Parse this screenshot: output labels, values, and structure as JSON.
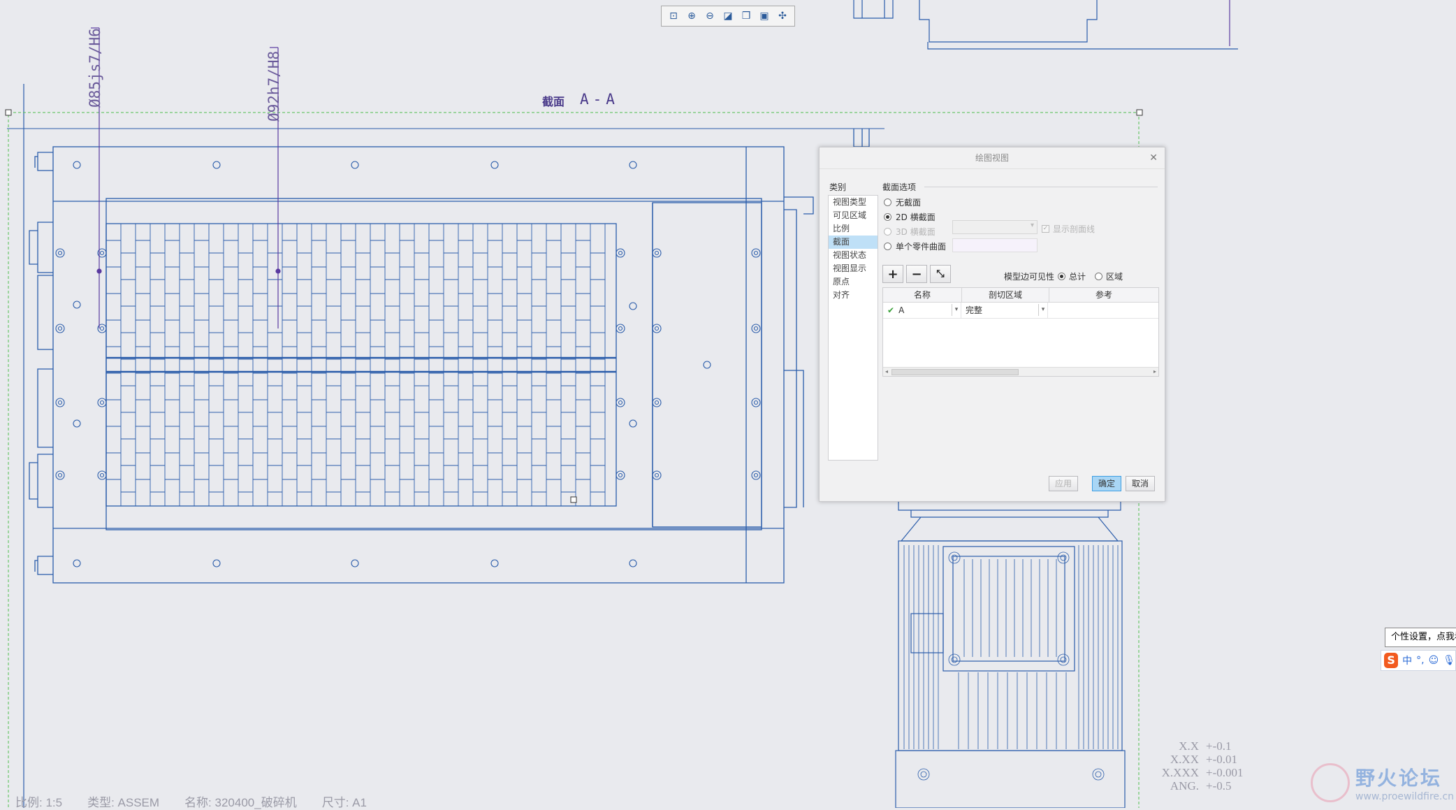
{
  "toolbar": {
    "icons": [
      "zoom-fit-icon",
      "zoom-in-icon",
      "zoom-out-icon",
      "repaint-icon",
      "view-orient-icon",
      "named-view-icon",
      "annotation-display-icon"
    ]
  },
  "drawing": {
    "section_label": "截面",
    "section_name": "A-A",
    "dimension_1": "Ø85js7/H6",
    "dimension_2": "Ø92h7/H8"
  },
  "status_bar": {
    "scale": "比例: 1:5",
    "type": "类型: ASSEM",
    "name": "名称: 320400_破碎机",
    "size": "尺寸: A1"
  },
  "tolerances": [
    {
      "label": "X.X",
      "value": "+-0.1"
    },
    {
      "label": "X.XX",
      "value": "+-0.01"
    },
    {
      "label": "X.XXX",
      "value": "+-0.001"
    },
    {
      "label": "ANG.",
      "value": "+-0.5"
    }
  ],
  "dialog": {
    "title": "绘图视图",
    "category_label": "类别",
    "categories": [
      "视图类型",
      "可见区域",
      "比例",
      "截面",
      "视图状态",
      "视图显示",
      "原点",
      "对齐"
    ],
    "active_category": "截面",
    "section_options_label": "截面选项",
    "radio_none": "无截面",
    "radio_2d": "2D 横截面",
    "radio_3d": "3D 横截面",
    "radio_surface": "单个零件曲面",
    "show_hatch": "显示剖面线",
    "model_edge_visibility": "模型边可见性",
    "vis_total": "总计",
    "vis_area": "区域",
    "col_name": "名称",
    "col_cut_area": "剖切区域",
    "col_reference": "参考",
    "row_name": "A",
    "row_cut_area": "完整",
    "btn_apply": "应用",
    "btn_ok": "确定",
    "btn_cancel": "取消"
  },
  "ime": {
    "tooltip": "个性设置，点我看看",
    "mode": "中",
    "punct": "°,"
  },
  "watermark": {
    "title": "野火论坛",
    "url": "www.proewildfire.cn"
  },
  "colors": {
    "drawing_line": "#2a5caa",
    "dim_line": "#5a3aa0",
    "view_border": "#4fbf4f",
    "background": "#e9eaee"
  }
}
